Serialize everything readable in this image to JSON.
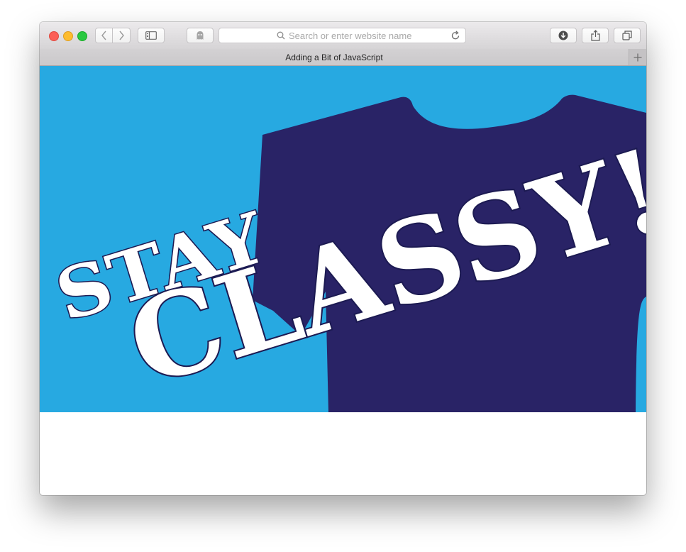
{
  "browser": {
    "address_placeholder": "Search or enter website name",
    "tab_title": "Adding a Bit of JavaScript",
    "icons": {
      "back": "chevron-left-icon",
      "forward": "chevron-right-icon",
      "sidebar": "sidebar-icon",
      "private": "ghost-icon",
      "search": "search-icon",
      "reload": "reload-icon",
      "download": "download-icon",
      "share": "share-icon",
      "tabs": "tabs-overview-icon",
      "new_tab": "plus-icon"
    }
  },
  "page": {
    "hero": {
      "line1": "STAY",
      "line2": "CLASSY!",
      "colors": {
        "background": "#27a9e1",
        "shirt": "#292366",
        "text": "#ffffff"
      }
    }
  }
}
